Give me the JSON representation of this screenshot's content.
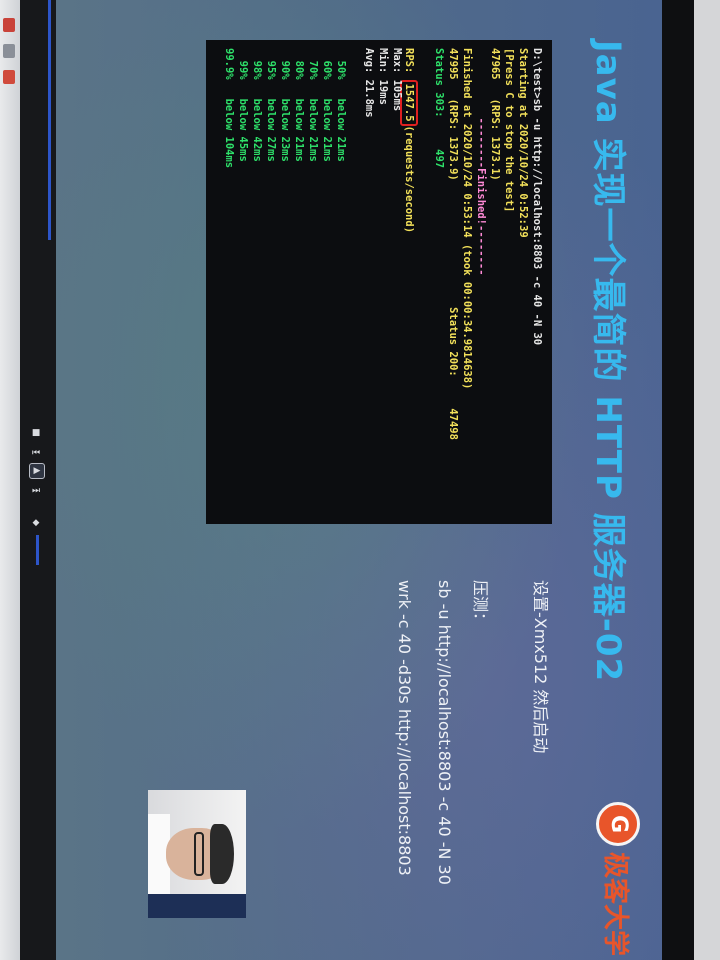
{
  "slide": {
    "title": "Java 实现一个最简的 HTTP 服务器-02",
    "brand_text": "极客大学",
    "brand_icon": "geek-logo-icon",
    "notes": [
      "设置-Xmx512 然后启动",
      "压测：",
      "sb -u http://localhost:8803 -c 40 -N 30",
      "wrk -c 40 -d30s http://localhost:8803"
    ]
  },
  "terminal": {
    "lines": [
      {
        "text": "D:\\test>sb -u http://localhost:8803 -c 40 -N 30",
        "color": "white"
      },
      {
        "text": "Starting at 2020/10/24 0:52:39",
        "color": "yellow"
      },
      {
        "text": "[Press C to stop the test]",
        "color": "yellow"
      },
      {
        "text": "47965   (RPS: 1373.1)",
        "color": "yellow"
      },
      {
        "text": "           --------Finished!--------",
        "color": "pink"
      },
      {
        "text": "Finished at 2020/10/24 0:53:14 (took 00:00:34.9814638)",
        "color": "yellow"
      },
      {
        "text": "47995   (RPS: 1373.9)                    Status 200:     47498",
        "color": "yellow"
      },
      {
        "text": "Status 303:     497",
        "color": "green"
      },
      {
        "text": "",
        "color": "white"
      },
      {
        "text": "(requests/second)",
        "color": "yellow",
        "prefix": "RPS: ",
        "boxed": "1547.5"
      },
      {
        "text": "Max: 105ms",
        "color": "white"
      },
      {
        "text": "Min: 19ms",
        "color": "white"
      },
      {
        "text": "Avg: 21.8ms",
        "color": "white"
      },
      {
        "text": "",
        "color": "white"
      },
      {
        "text": "  50%   below 21ms",
        "color": "green"
      },
      {
        "text": "  60%   below 21ms",
        "color": "green"
      },
      {
        "text": "  70%   below 21ms",
        "color": "green"
      },
      {
        "text": "  80%   below 21ms",
        "color": "green"
      },
      {
        "text": "  90%   below 23ms",
        "color": "green"
      },
      {
        "text": "  95%   below 27ms",
        "color": "green"
      },
      {
        "text": "  98%   below 42ms",
        "color": "green"
      },
      {
        "text": "  99%   below 45ms",
        "color": "green"
      },
      {
        "text": "99.9%   below 104ms",
        "color": "green"
      }
    ]
  },
  "player": {
    "stop_icon": "stop-icon",
    "prev_icon": "skip-back-icon",
    "play_icon": "play-icon",
    "next_icon": "skip-forward-icon",
    "volume_icon": "volume-icon"
  }
}
